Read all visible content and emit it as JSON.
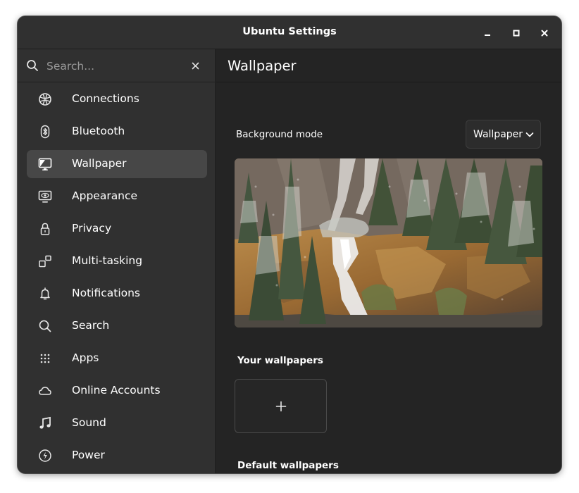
{
  "window": {
    "title": "Ubuntu Settings",
    "controls": [
      "minimize-icon",
      "maximize-icon",
      "close-icon"
    ]
  },
  "sidebar": {
    "search": {
      "placeholder": "Search...",
      "value": ""
    },
    "items": [
      {
        "label": "Connections",
        "icon": "network-globe-icon",
        "active": false
      },
      {
        "label": "Bluetooth",
        "icon": "bluetooth-icon",
        "active": false
      },
      {
        "label": "Wallpaper",
        "icon": "monitor-wallpaper-icon",
        "active": true
      },
      {
        "label": "Appearance",
        "icon": "appearance-icon",
        "active": false
      },
      {
        "label": "Privacy",
        "icon": "lock-icon",
        "active": false
      },
      {
        "label": "Multi-tasking",
        "icon": "multitasking-icon",
        "active": false
      },
      {
        "label": "Notifications",
        "icon": "bell-icon",
        "active": false
      },
      {
        "label": "Search",
        "icon": "search-icon",
        "active": false
      },
      {
        "label": "Apps",
        "icon": "apps-grid-icon",
        "active": false
      },
      {
        "label": "Online Accounts",
        "icon": "cloud-icon",
        "active": false
      },
      {
        "label": "Sound",
        "icon": "music-note-icon",
        "active": false
      },
      {
        "label": "Power",
        "icon": "power-icon",
        "active": false
      }
    ]
  },
  "main": {
    "title": "Wallpaper",
    "background_mode": {
      "label": "Background mode",
      "selected": "Wallpaper"
    },
    "your_wallpapers_label": "Your wallpapers",
    "default_wallpapers_label": "Default wallpapers"
  },
  "colors": {
    "window_bg": "#242424",
    "sidebar_bg": "#303030",
    "active_item_bg": "#474747",
    "text": "#ffffff",
    "muted_text": "#9a9a9a"
  }
}
